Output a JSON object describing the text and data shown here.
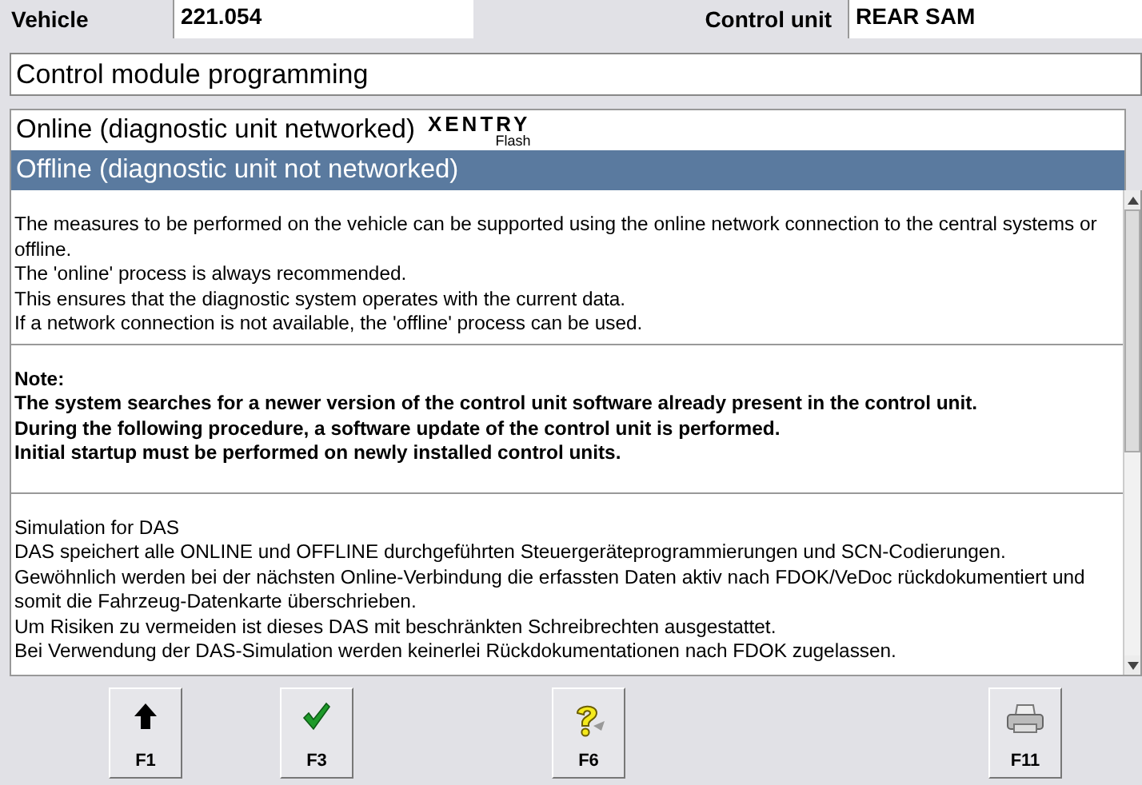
{
  "header": {
    "vehicle_label": "Vehicle",
    "vehicle_value": "221.054",
    "control_unit_label": "Control unit",
    "control_unit_value": "REAR SAM"
  },
  "title": "Control module programming",
  "options": [
    {
      "label": "Online (diagnostic unit networked)",
      "selected": false,
      "logo": {
        "name": "XENTRY",
        "sub": "Flash"
      }
    },
    {
      "label": "Offline (diagnostic unit not networked)",
      "selected": true
    }
  ],
  "sections": [
    {
      "kind": "plain",
      "lines": [
        "The measures to be performed on the vehicle can be supported using the online network connection to the central systems or offline.",
        "The 'online' process is always recommended.",
        "This ensures that the diagnostic system operates with the current data.",
        "If a network connection is not available, the 'offline' process can be used."
      ]
    },
    {
      "kind": "bold",
      "lines": [
        "Note:",
        "The system searches for a newer version of the control unit software already present in the control unit.",
        "During the following procedure, a software update of the control unit is performed.",
        "Initial startup must be performed on newly installed control units."
      ]
    },
    {
      "kind": "plain",
      "lines": [
        "Simulation for DAS",
        "DAS speichert alle ONLINE und OFFLINE durchgeführten Steuergeräteprogrammierungen und SCN-Codierungen.",
        "Gewöhnlich werden bei der nächsten Online-Verbindung die erfassten Daten aktiv nach FDOK/VeDoc rückdokumentiert und somit die Fahrzeug-Datenkarte überschrieben.",
        "Um Risiken zu vermeiden ist dieses DAS mit beschränkten Schreibrechten ausgestattet.",
        "Bei Verwendung der DAS-Simulation werden keinerlei Rückdokumentationen nach FDOK zugelassen."
      ]
    }
  ],
  "function_keys": [
    {
      "label": "F1",
      "kind": "up"
    },
    {
      "label": "F3",
      "kind": "check"
    },
    {
      "label": "F6",
      "kind": "help"
    },
    {
      "label": "F11",
      "kind": "print"
    }
  ]
}
